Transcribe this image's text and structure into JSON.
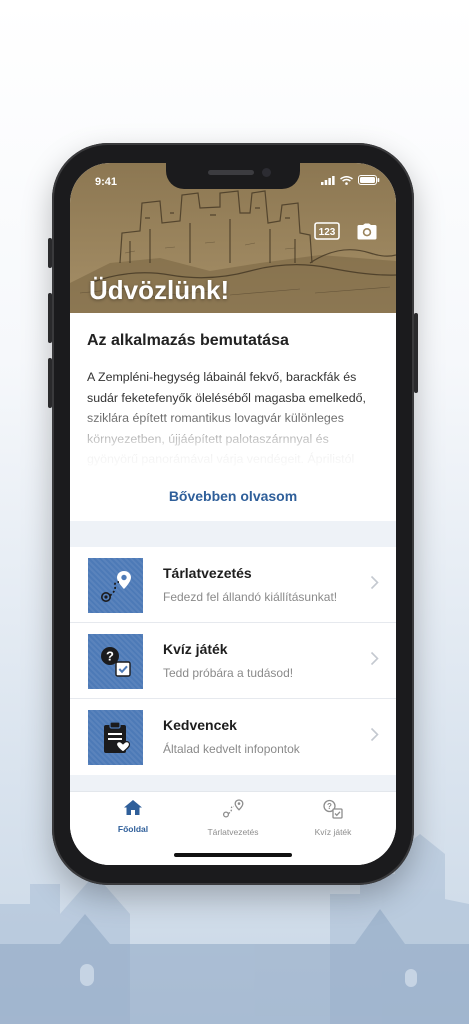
{
  "status_bar": {
    "time": "9:41"
  },
  "hero": {
    "title": "Üdvözlünk!",
    "number_badge": "123"
  },
  "intro": {
    "title": "Az alkalmazás bemutatása",
    "text": "A Zempléni-hegység lábainál fekvő, barackfák és sudár feketefenyők öleléséből magasba emelkedő, sziklára épített romantikus lovagvár különleges környezetben, újjáépített palotaszárnnyal és gyönyörű panorámával várja vendégeit. Áprilistól októberig végig látogatható...",
    "read_more": "Bővebben olvasom"
  },
  "menu": {
    "items": [
      {
        "title": "Tárlatvezetés",
        "subtitle": "Fedezd fel állandó kiállításunkat!",
        "icon": "route-map-icon"
      },
      {
        "title": "Kvíz játék",
        "subtitle": "Tedd próbára a tudásod!",
        "icon": "quiz-icon"
      },
      {
        "title": "Kedvencek",
        "subtitle": "Általad kedvelt infopontok",
        "icon": "favorites-clipboard-icon"
      }
    ]
  },
  "tabbar": {
    "tabs": [
      {
        "label": "Főoldal",
        "icon": "home-icon",
        "active": true
      },
      {
        "label": "Tárlatvezetés",
        "icon": "route-icon",
        "active": false
      },
      {
        "label": "Kvíz játék",
        "icon": "quiz-icon",
        "active": false
      }
    ]
  },
  "colors": {
    "accent": "#2f5f9a",
    "tile": "#4d7ab7",
    "hero": "#9a845d",
    "band": "#eef2f7"
  }
}
